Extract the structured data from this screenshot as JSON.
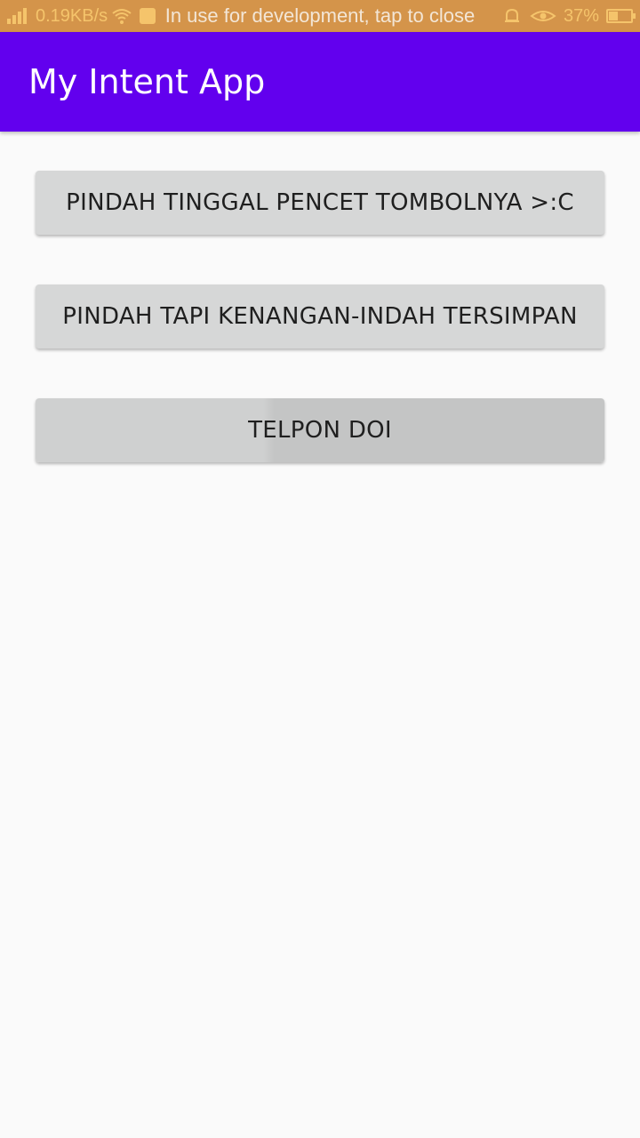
{
  "status_bar": {
    "speed": "0.19KB/s",
    "overlay_text": "In use for development, tap to close",
    "battery": "37%",
    "battery_level": 0.37,
    "color": "#d4944a",
    "icons": [
      "signal-icon",
      "wifi-icon",
      "notification-icon",
      "vibrate-icon",
      "bell-icon",
      "eye-icon",
      "battery-icon"
    ]
  },
  "app_bar": {
    "title": "My Intent App",
    "color": "#6200ee"
  },
  "buttons": [
    {
      "label": "PINDAH TINGGAL PENCET TOMBOLNYA >:C"
    },
    {
      "label": "PINDAH TAPI KENANGAN-INDAH TERSIMPAN"
    },
    {
      "label": "TELPON DOI"
    }
  ],
  "colors": {
    "background": "#fafafa",
    "button": "#d6d7d7",
    "button_text": "#1f1f1f"
  }
}
